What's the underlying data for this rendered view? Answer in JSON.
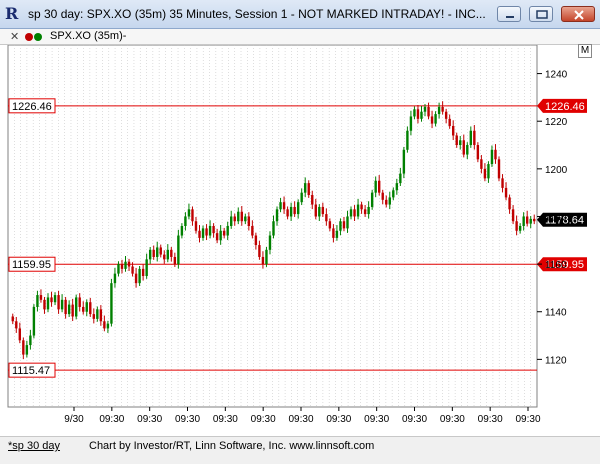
{
  "window": {
    "title": "sp 30 day: SPX.XO (35m) 35 Minutes, Session 1 - NOT MARKED INTRADAY! - INC...",
    "icon": "investor-rt-logo-icon"
  },
  "toolbar": {
    "close_glyph": "✕",
    "symbol_label": "SPX.XO (35m)-",
    "m_button": "M"
  },
  "footer": {
    "tab_label": "*sp 30 day",
    "credit": "Chart by Investor/RT, Linn Software, Inc. www.linnsoft.com"
  },
  "chart_data": {
    "type": "candlestick",
    "ylim": [
      1100,
      1252
    ],
    "y_ticks": [
      1120,
      1140,
      1160,
      1180,
      1200,
      1220,
      1240
    ],
    "x_tick_labels": [
      "9/30",
      "09:30",
      "09:30",
      "09:30",
      "09:30",
      "09:30",
      "09:30",
      "09:30",
      "09:30",
      "09:30",
      "09:30",
      "09:30",
      "09:30"
    ],
    "levels": [
      {
        "value": 1226.46,
        "label": "1226.46",
        "side": "both"
      },
      {
        "value": 1159.95,
        "label": "1159.95",
        "side": "both"
      },
      {
        "value": 1115.47,
        "label": "1115.47",
        "side": "left"
      }
    ],
    "last_price": {
      "value": 1178.64,
      "label": "1178.64"
    },
    "colors": {
      "up": "#008000",
      "down": "#c00000",
      "level": "#e00000",
      "grid": "#c8c8c8"
    },
    "closes": [
      1136,
      1133,
      1128,
      1122,
      1126,
      1130,
      1142,
      1147,
      1145,
      1141,
      1146,
      1144,
      1147,
      1141,
      1145,
      1139,
      1143,
      1138,
      1146,
      1142,
      1140,
      1144,
      1139,
      1137,
      1141,
      1136,
      1133,
      1135,
      1152,
      1156,
      1160,
      1158,
      1161,
      1159,
      1156,
      1152,
      1158,
      1155,
      1162,
      1166,
      1163,
      1167,
      1164,
      1162,
      1166,
      1163,
      1160,
      1172,
      1176,
      1180,
      1183,
      1178,
      1174,
      1171,
      1175,
      1172,
      1176,
      1173,
      1170,
      1174,
      1172,
      1176,
      1180,
      1178,
      1182,
      1178,
      1180,
      1176,
      1172,
      1168,
      1163,
      1160,
      1166,
      1172,
      1178,
      1183,
      1186,
      1183,
      1180,
      1184,
      1181,
      1186,
      1190,
      1194,
      1189,
      1185,
      1180,
      1184,
      1181,
      1178,
      1175,
      1171,
      1174,
      1178,
      1175,
      1180,
      1183,
      1180,
      1185,
      1183,
      1181,
      1184,
      1190,
      1195,
      1190,
      1187,
      1185,
      1188,
      1191,
      1194,
      1198,
      1208,
      1216,
      1222,
      1225,
      1221,
      1224,
      1226,
      1222,
      1219,
      1223,
      1226,
      1224,
      1221,
      1218,
      1214,
      1210,
      1212,
      1206,
      1210,
      1216,
      1210,
      1204,
      1200,
      1196,
      1202,
      1208,
      1204,
      1196,
      1192,
      1188,
      1183,
      1178,
      1174,
      1176,
      1180,
      1177,
      1179,
      1178
    ]
  }
}
